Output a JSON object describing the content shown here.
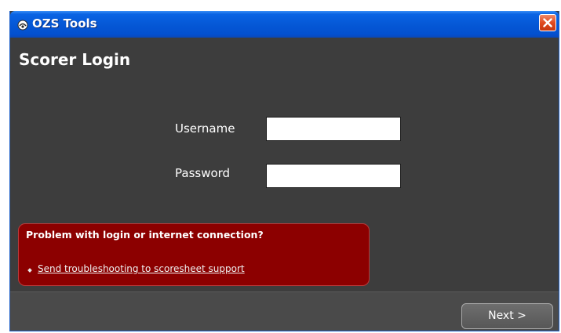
{
  "window": {
    "title": "OZS Tools",
    "icon": "app-logo-icon",
    "close_icon": "close-icon",
    "titlebar_color": "#0558d6",
    "close_color": "#e04a1f"
  },
  "page": {
    "title": "Scorer Login",
    "background": "#3d3d3d"
  },
  "form": {
    "username_label": "Username",
    "username_value": "",
    "password_label": "Password",
    "password_value": ""
  },
  "help": {
    "title": "Problem with login or internet connection?",
    "link_text": "Send troubleshooting to scoresheet support",
    "background": "#8c0000"
  },
  "footer": {
    "next_label": "Next >"
  }
}
